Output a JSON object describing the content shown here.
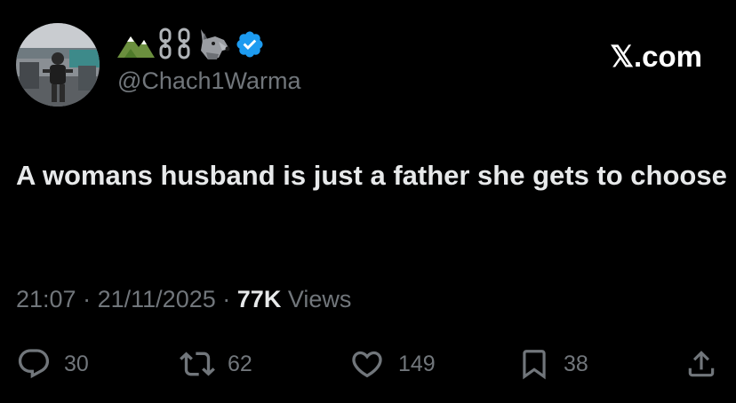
{
  "profile": {
    "emoji": [
      "mountain-emoji",
      "chains-emoji",
      "wolf-emoji"
    ],
    "verified_icon": "verified-badge-icon",
    "handle": "@Chach1Warma"
  },
  "brand": "𝕏.com",
  "tweet": {
    "text": "A womans husband is just a father she gets to choose"
  },
  "meta": {
    "time": "21:07",
    "date": "21/11/2025",
    "separator": "·",
    "views_count": "77K",
    "views_label": "Views"
  },
  "actions": {
    "replies": "30",
    "reposts": "62",
    "likes": "149",
    "bookmarks": "38"
  },
  "colors": {
    "background": "#000000",
    "text": "#e7e9ea",
    "muted": "#71767b",
    "verified": "#1d9bf0"
  }
}
